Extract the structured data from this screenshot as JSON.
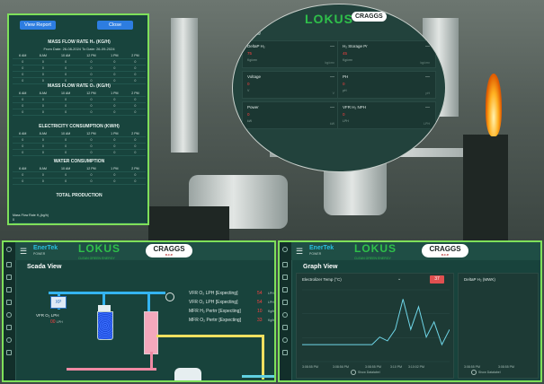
{
  "report": {
    "view_report_label": "View Report",
    "close_label": "Close",
    "sections": [
      {
        "title": "MASS FLOW RATE H₂ (KG/H)",
        "subtitle": "From Date: 26-08-2024     To Date: 26-09-2024",
        "headers": [
          "6 AM",
          "8 AM",
          "10 AM",
          "12 PM",
          "1 PM",
          "2 PM"
        ],
        "rows": [
          [
            "0",
            "0",
            "0",
            "0",
            "0",
            "0"
          ],
          [
            "0",
            "0",
            "0",
            "0",
            "0",
            "0"
          ],
          [
            "0",
            "0",
            "0",
            "0",
            "0",
            "0"
          ],
          [
            "0",
            "0",
            "0",
            "0",
            "0",
            "0"
          ]
        ]
      },
      {
        "title": "MASS FLOW RATE O₂ (KG/H)",
        "subtitle": "",
        "headers": [
          "6 AM",
          "8 AM",
          "10 AM",
          "12 PM",
          "1 PM",
          "2 PM"
        ],
        "rows": [
          [
            "0",
            "0",
            "0",
            "0",
            "0",
            "0"
          ],
          [
            "0",
            "0",
            "0",
            "0",
            "0",
            "0"
          ],
          [
            "0",
            "0",
            "0",
            "0",
            "0",
            "0"
          ]
        ]
      },
      {
        "title": "ELECTRICITY CONSUMPTION (KW/H)",
        "subtitle": "",
        "headers": [
          "6 AM",
          "8 AM",
          "10 AM",
          "12 PM",
          "1 PM",
          "2 PM"
        ],
        "rows": [
          [
            "0",
            "0",
            "0",
            "0",
            "0",
            "0"
          ],
          [
            "0",
            "0",
            "0",
            "0",
            "0",
            "0"
          ],
          [
            "0",
            "0",
            "0",
            "0",
            "0",
            "0"
          ]
        ]
      },
      {
        "title": "WATER CONSUMPTION",
        "subtitle": "",
        "headers": [
          "6 AM",
          "8 AM",
          "10 AM",
          "12 PM",
          "1 PM",
          "2 PM"
        ],
        "rows": [
          [
            "0",
            "0",
            "0",
            "0",
            "0",
            "0"
          ],
          [
            "0",
            "0",
            "0",
            "0",
            "0",
            "0"
          ]
        ]
      },
      {
        "title": "TOTAL PRODUCTION",
        "subtitle": "",
        "headers": [],
        "rows": []
      }
    ],
    "mass_flow_label": "Mass Flow Rate H₂(kg/h)",
    "mass_flow_value": "0"
  },
  "circle": {
    "logo": "LOKUS",
    "partner": "CRAGGS",
    "view_label": "View",
    "cards": [
      {
        "title": "DeltaP H₂",
        "value": "75",
        "unit": "Kg/cm²",
        "meta": "—",
        "foot": "kg/cm²"
      },
      {
        "title": "H₂ Storage Pr",
        "value": "45",
        "unit": "Kg/cm²",
        "meta": "—",
        "foot": "kg/cm²"
      },
      {
        "title": "Voltage",
        "value": "0",
        "unit": "V",
        "meta": "—",
        "foot": "V"
      },
      {
        "title": "PH",
        "value": "0",
        "unit": "pH",
        "meta": "—",
        "foot": "pH"
      },
      {
        "title": "Power",
        "value": "0",
        "unit": "kW",
        "meta": "—",
        "foot": "kW"
      },
      {
        "title": "VFR H₂ NPH",
        "value": "0",
        "unit": "LPH",
        "meta": "—",
        "foot": "LPH"
      }
    ]
  },
  "scada": {
    "brand": "EnerTek",
    "brand_sub": "POWER",
    "logo": "LOKUS",
    "logo_sub": "CLEAN GREEN ENERGY",
    "partner": "CRAGGS",
    "partner_sub": "R.C.P.",
    "title": "Scada View",
    "sensor_label": "VFR O₂ LPH",
    "sensor_value": "00",
    "sensor_unit": "LPH",
    "rows": [
      {
        "label": "VFR O₂ LPH [Expecting]",
        "value": "54",
        "unit": "LPH"
      },
      {
        "label": "VFR O₂ LPH [Expecting]",
        "value": "54",
        "unit": "LPH"
      },
      {
        "label": "MFR H₂ Pertrr [Expecting]",
        "value": "10",
        "unit": "Kg/hr"
      },
      {
        "label": "MFR O₂ Pertrr [Expecting]",
        "value": "33",
        "unit": "Kg/hr"
      }
    ]
  },
  "graph": {
    "brand": "EnerTek",
    "brand_sub": "POWER",
    "logo": "LOKUS",
    "logo_sub": "CLEAN GREEN ENERGY",
    "partner": "CRAGGS",
    "partner_sub": "R.C.P.",
    "title": "Graph View",
    "panel1_title": "Electrolizer Temp (°C)",
    "panel1_badge": "37",
    "panel2_title": "DeltaP H₂ (MWK)",
    "x_labels": [
      "3:08:55 PM",
      "3:08:56 PM",
      "3:08:55 PM",
      "3:10 PM",
      "3:10:02 PM",
      "3:08:55 PM"
    ],
    "x_labels_2": [
      "3:08:55 PM",
      "3:08:55 PM"
    ],
    "show_datalabel": "Show Datalabel"
  },
  "chart_data": {
    "type": "line",
    "title": "Electrolizer Temp (°C)",
    "series": [
      {
        "name": "Electrolizer Temp (°C)",
        "values": [
          2,
          2,
          2,
          2,
          2,
          2,
          2,
          2,
          2,
          2,
          3,
          2.5,
          4,
          8,
          4,
          7,
          3,
          5,
          2,
          4
        ]
      }
    ]
  }
}
